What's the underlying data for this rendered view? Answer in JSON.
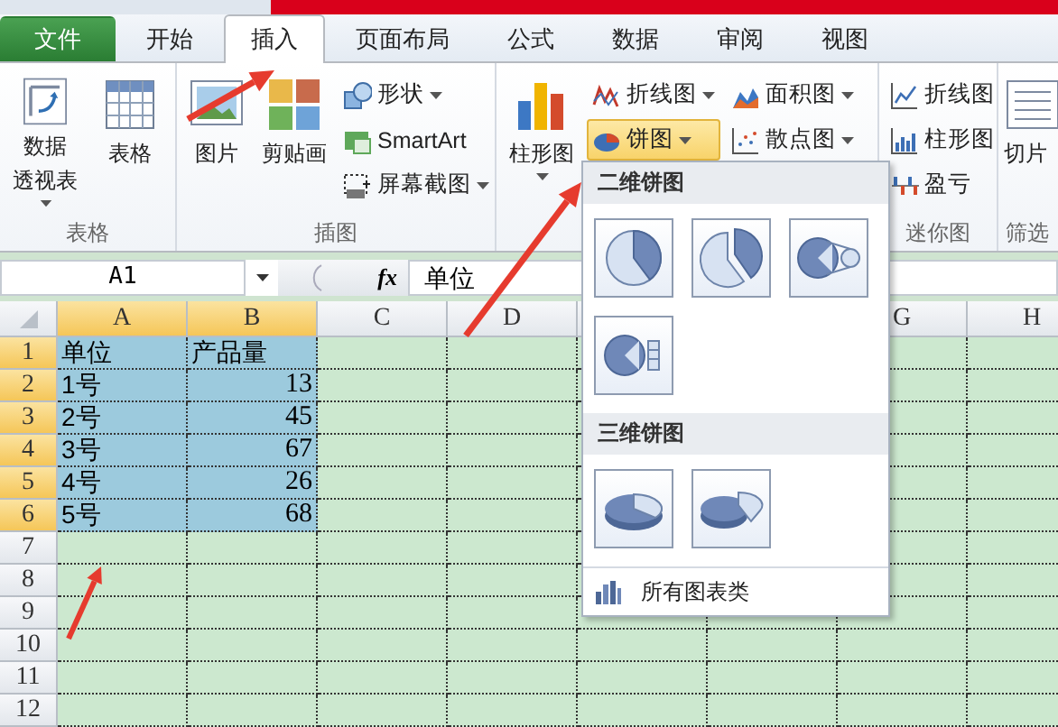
{
  "tabs": [
    {
      "label": "文件",
      "kind": "file",
      "selected": false
    },
    {
      "label": "开始",
      "kind": "tab",
      "selected": false
    },
    {
      "label": "插入",
      "kind": "tab",
      "selected": true
    },
    {
      "label": "页面布局",
      "kind": "tab",
      "selected": false
    },
    {
      "label": "公式",
      "kind": "tab",
      "selected": false
    },
    {
      "label": "数据",
      "kind": "tab",
      "selected": false
    },
    {
      "label": "审阅",
      "kind": "tab",
      "selected": false
    },
    {
      "label": "视图",
      "kind": "tab",
      "selected": false
    }
  ],
  "ribbon": {
    "groups": [
      {
        "label": "表格",
        "buttons": [
          {
            "kind": "large",
            "lines": [
              "数据",
              "透视表"
            ],
            "dropdown": true,
            "open": false
          },
          {
            "kind": "large",
            "lines": [
              "表格"
            ],
            "dropdown": false,
            "open": false
          }
        ]
      },
      {
        "label": "插图",
        "buttons": [
          {
            "kind": "large",
            "lines": [
              "图片"
            ],
            "dropdown": false,
            "open": false
          },
          {
            "kind": "large",
            "lines": [
              "剪贴画"
            ],
            "dropdown": false,
            "open": false
          },
          {
            "kind": "stack",
            "items": [
              {
                "label": "形状",
                "dropdown": true,
                "open": false
              },
              {
                "label": "SmartArt",
                "dropdown": false,
                "open": false
              },
              {
                "label": "屏幕截图",
                "dropdown": true,
                "open": false
              }
            ]
          }
        ]
      },
      {
        "buttons": [
          {
            "kind": "large",
            "lines": [
              "柱形图"
            ],
            "dropdown": true,
            "open": false
          },
          {
            "kind": "stack",
            "items": [
              {
                "label": "折线图",
                "dropdown": true,
                "open": false
              },
              {
                "label": "饼图",
                "dropdown": true,
                "open": true
              }
            ]
          },
          {
            "kind": "stack",
            "items": [
              {
                "label": "面积图",
                "dropdown": true,
                "open": false
              },
              {
                "label": "散点图",
                "dropdown": true,
                "open": false
              }
            ]
          }
        ]
      },
      {
        "label": "迷你图",
        "buttons": [
          {
            "kind": "stack",
            "items": [
              {
                "label": "折线图",
                "dropdown": false,
                "open": false
              },
              {
                "label": "柱形图",
                "dropdown": false,
                "open": false
              },
              {
                "label": "盈亏",
                "dropdown": false,
                "open": false
              }
            ]
          }
        ]
      },
      {
        "label": "筛选",
        "buttons": [
          {
            "kind": "large",
            "lines": [
              "切片"
            ],
            "dropdown": false,
            "open": false
          }
        ]
      }
    ]
  },
  "formula_bar": {
    "name_box": "A1",
    "function_label": "fx",
    "value": "单位"
  },
  "sheet": {
    "columns": [
      "A",
      "B",
      "C",
      "D",
      "G",
      "H"
    ],
    "rows": [
      {
        "number": "1",
        "cells": [
          {
            "text": "单位",
            "kind": "text",
            "selected": true
          },
          {
            "text": "产品量",
            "kind": "text",
            "selected": true
          }
        ]
      },
      {
        "number": "2",
        "cells": [
          {
            "text": "1号",
            "kind": "text",
            "selected": true
          },
          {
            "text": "13",
            "kind": "number",
            "selected": true
          }
        ]
      },
      {
        "number": "3",
        "cells": [
          {
            "text": "2号",
            "kind": "text",
            "selected": true
          },
          {
            "text": "45",
            "kind": "number",
            "selected": true
          }
        ]
      },
      {
        "number": "4",
        "cells": [
          {
            "text": "3号",
            "kind": "text",
            "selected": true
          },
          {
            "text": "67",
            "kind": "number",
            "selected": true
          }
        ]
      },
      {
        "number": "5",
        "cells": [
          {
            "text": "4号",
            "kind": "text",
            "selected": true
          },
          {
            "text": "26",
            "kind": "number",
            "selected": true
          }
        ]
      },
      {
        "number": "6",
        "cells": [
          {
            "text": "5号",
            "kind": "text",
            "selected": true
          },
          {
            "text": "68",
            "kind": "number",
            "selected": true
          }
        ]
      },
      {
        "number": "7"
      },
      {
        "number": "8"
      },
      {
        "number": "9"
      },
      {
        "number": "10"
      },
      {
        "number": "11"
      },
      {
        "number": "12"
      }
    ]
  },
  "pie_menu": {
    "sections": [
      {
        "title": "二维饼图",
        "options": [
          {
            "kind": "pie"
          },
          {
            "kind": "exploded"
          },
          {
            "kind": "pie-of-pie"
          },
          {
            "kind": "bar-of-pie"
          }
        ]
      },
      {
        "title": "三维饼图",
        "options": [
          {
            "kind": "pie-3d"
          },
          {
            "kind": "exploded-3d"
          }
        ]
      }
    ],
    "footer": "所有图表类"
  }
}
